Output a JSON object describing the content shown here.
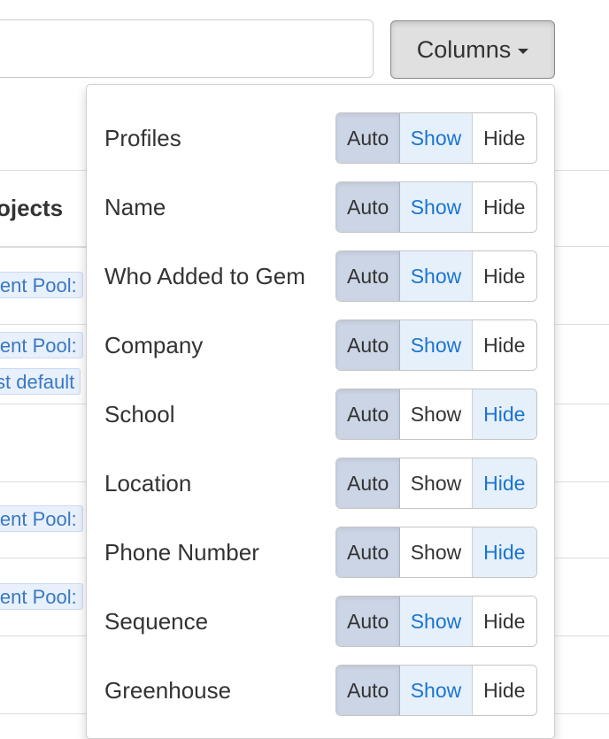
{
  "toolbar": {
    "search_value": "",
    "columns_label": "Columns"
  },
  "table": {
    "header": "ojects",
    "tags": [
      {
        "label": "lent Pool:"
      },
      {
        "label": "lent Pool:"
      },
      {
        "label": "st default"
      },
      {
        "label": "lent Pool:"
      },
      {
        "label": "lent Pool:"
      }
    ]
  },
  "dropdown": {
    "options": {
      "auto": "Auto",
      "show": "Show",
      "hide": "Hide"
    },
    "rows": [
      {
        "label": "Profiles",
        "active": "show"
      },
      {
        "label": "Name",
        "active": "show"
      },
      {
        "label": "Who Added to Gem",
        "active": "show"
      },
      {
        "label": "Company",
        "active": "show"
      },
      {
        "label": "School",
        "active": "hide"
      },
      {
        "label": "Location",
        "active": "hide"
      },
      {
        "label": "Phone Number",
        "active": "hide"
      },
      {
        "label": "Sequence",
        "active": "show"
      },
      {
        "label": "Greenhouse",
        "active": "show"
      }
    ]
  },
  "colors": {
    "active_text": "#1a74d1",
    "active_bg": "#e6f0fb",
    "auto_bg": "#cbd5e5"
  }
}
